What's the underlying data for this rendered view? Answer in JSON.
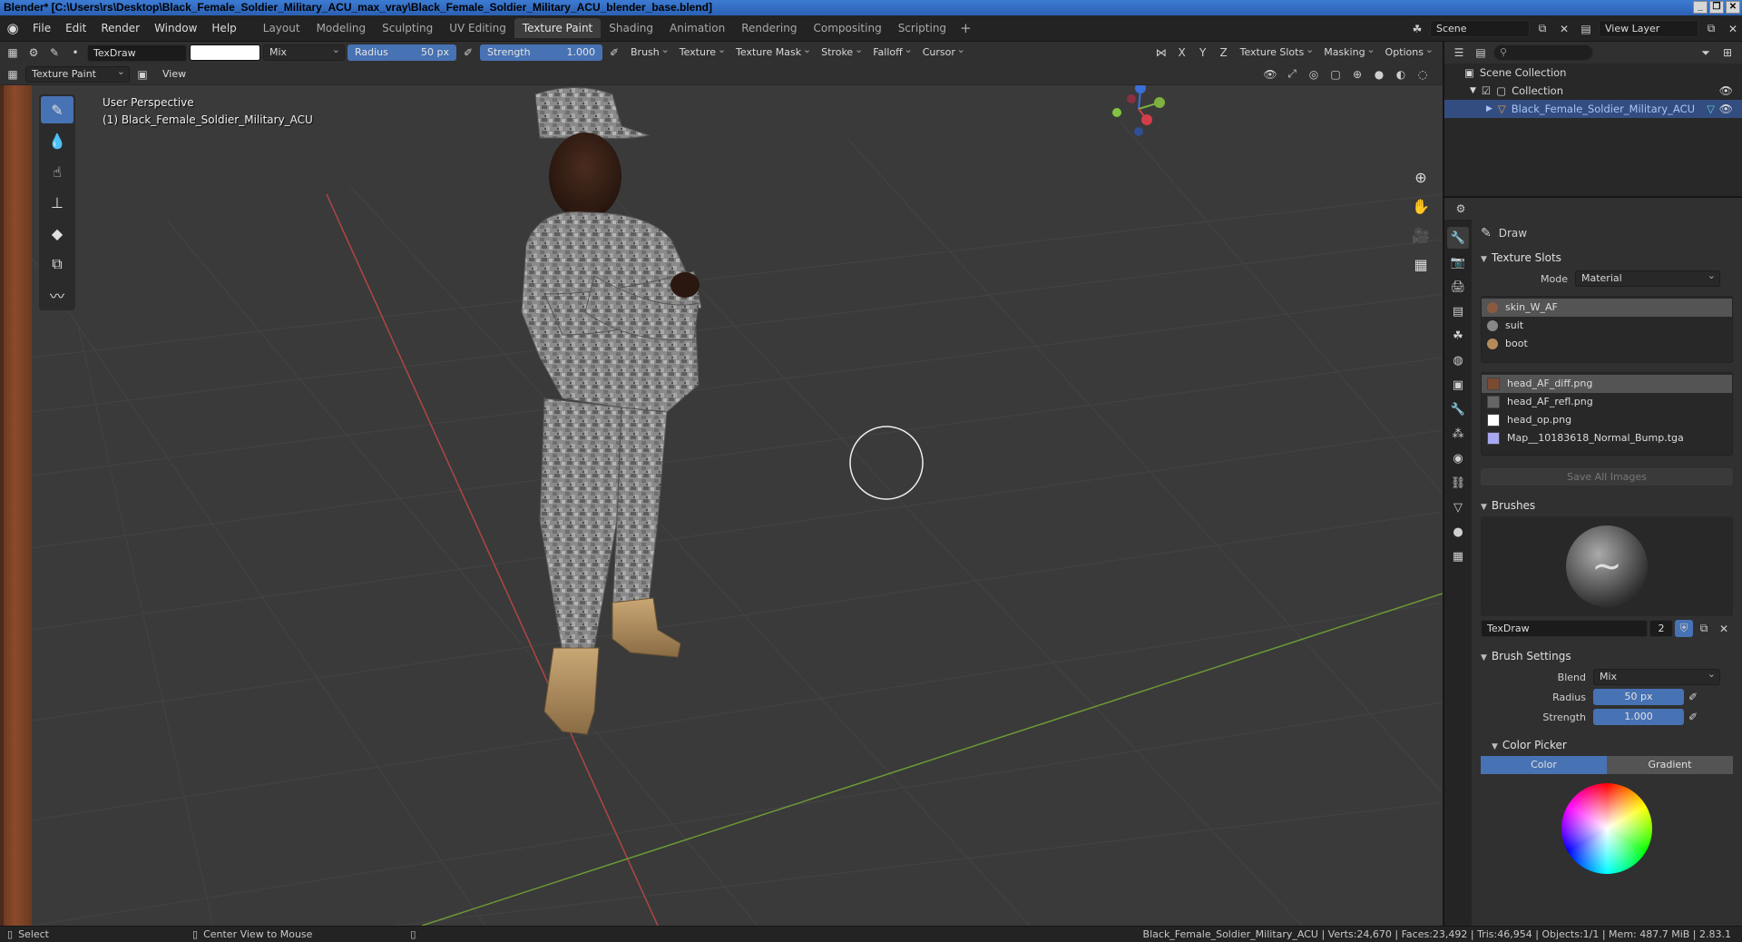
{
  "window": {
    "title": "Blender* [C:\\Users\\rs\\Desktop\\Black_Female_Soldier_Military_ACU_max_vray\\Black_Female_Soldier_Military_ACU_blender_base.blend]"
  },
  "menubar": {
    "items": [
      "File",
      "Edit",
      "Render",
      "Window",
      "Help"
    ],
    "workspaces": [
      "Layout",
      "Modeling",
      "Sculpting",
      "UV Editing",
      "Texture Paint",
      "Shading",
      "Animation",
      "Rendering",
      "Compositing",
      "Scripting"
    ],
    "active_workspace": "Texture Paint",
    "scene": "Scene",
    "view_layer": "View Layer"
  },
  "toolheader": {
    "brush_name": "TexDraw",
    "blend": "Mix",
    "radius_label": "Radius",
    "radius_value": "50 px",
    "strength_label": "Strength",
    "strength_value": "1.000",
    "menus": [
      "Brush",
      "Texture",
      "Texture Mask",
      "Stroke",
      "Falloff",
      "Cursor"
    ],
    "axes": [
      "X",
      "Y",
      "Z"
    ],
    "right_menus": [
      "Texture Slots",
      "Masking",
      "Options"
    ]
  },
  "viewheader": {
    "mode": "Texture Paint",
    "view": "View"
  },
  "viewport": {
    "perspective": "User Perspective",
    "object_label": "(1) Black_Female_Soldier_Military_ACU"
  },
  "outliner": {
    "scene_collection": "Scene Collection",
    "collection": "Collection",
    "object": "Black_Female_Soldier_Military_ACU"
  },
  "properties": {
    "tool_name": "Draw",
    "texture_slots": {
      "title": "Texture Slots",
      "mode_label": "Mode",
      "mode_value": "Material",
      "materials": [
        "skin_W_AF",
        "suit",
        "boot"
      ],
      "images": [
        "head_AF_diff.png",
        "head_AF_refl.png",
        "head_op.png",
        "Map__10183618_Normal_Bump.tga"
      ],
      "save_all": "Save All Images"
    },
    "brushes": {
      "title": "Brushes",
      "brush_name": "TexDraw",
      "users": "2"
    },
    "brush_settings": {
      "title": "Brush Settings",
      "blend_label": "Blend",
      "blend_value": "Mix",
      "radius_label": "Radius",
      "radius_value": "50 px",
      "strength_label": "Strength",
      "strength_value": "1.000"
    },
    "color_picker": {
      "title": "Color Picker",
      "tab_color": "Color",
      "tab_gradient": "Gradient"
    }
  },
  "statusbar": {
    "select": "Select",
    "center_view": "Center View to Mouse",
    "stats": "Black_Female_Soldier_Military_ACU | Verts:24,670 | Faces:23,492 | Tris:46,954 | Objects:1/1 | Mem: 487.7 MiB | 2.83.1"
  }
}
